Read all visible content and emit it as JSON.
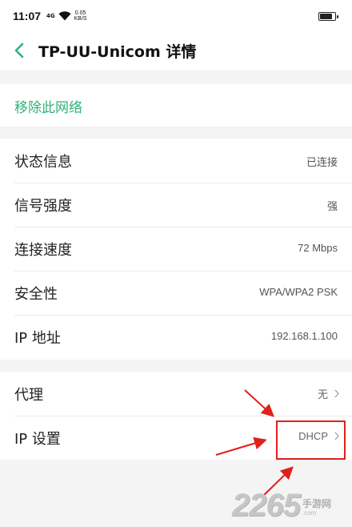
{
  "status_bar": {
    "time": "11:07",
    "network": "4G",
    "speed_value": "0.05",
    "speed_unit": "KB/S"
  },
  "header": {
    "title": "TP-UU-Unicom 详情"
  },
  "forget": {
    "label": "移除此网络",
    "color": "#2db37a"
  },
  "info": {
    "rows": [
      {
        "label": "状态信息",
        "value": "已连接"
      },
      {
        "label": "信号强度",
        "value": "强"
      },
      {
        "label": "连接速度",
        "value": "72 Mbps"
      },
      {
        "label": "安全性",
        "value": "WPA/WPA2 PSK"
      },
      {
        "label": "IP 地址",
        "value": "192.168.1.100"
      }
    ]
  },
  "settings": {
    "proxy": {
      "label": "代理",
      "value": "无"
    },
    "ip_settings": {
      "label": "IP 设置",
      "value": "DHCP"
    }
  },
  "watermark": {
    "number": "2265",
    "suffix": ".com",
    "site_cn": "手游网",
    "domain": "2265.com"
  },
  "annotation_color": "#e0201c"
}
